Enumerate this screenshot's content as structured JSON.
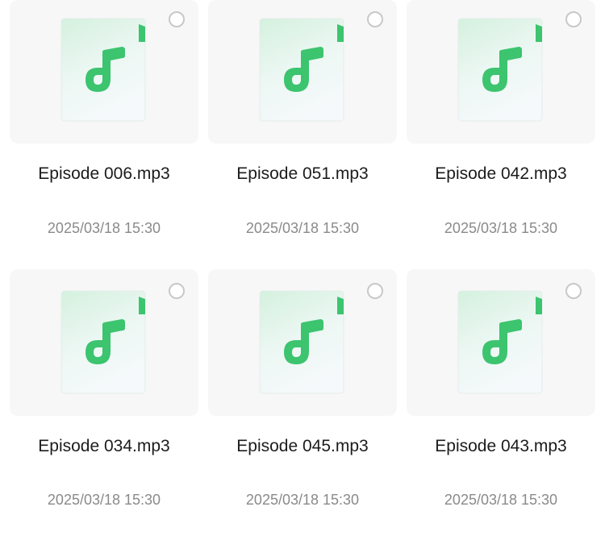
{
  "files": [
    {
      "name": "Episode 006.mp3",
      "date": "2025/03/18 15:30"
    },
    {
      "name": "Episode 051.mp3",
      "date": "2025/03/18 15:30"
    },
    {
      "name": "Episode 042.mp3",
      "date": "2025/03/18 15:30"
    },
    {
      "name": "Episode 034.mp3",
      "date": "2025/03/18 15:30"
    },
    {
      "name": "Episode 045.mp3",
      "date": "2025/03/18 15:30"
    },
    {
      "name": "Episode 043.mp3",
      "date": "2025/03/18 15:30"
    }
  ],
  "icon": {
    "name": "audio-file-icon",
    "accent_color": "#3cc46f",
    "page_color_top": "#d6f2e0",
    "page_color_bottom": "#f4f9fb"
  }
}
